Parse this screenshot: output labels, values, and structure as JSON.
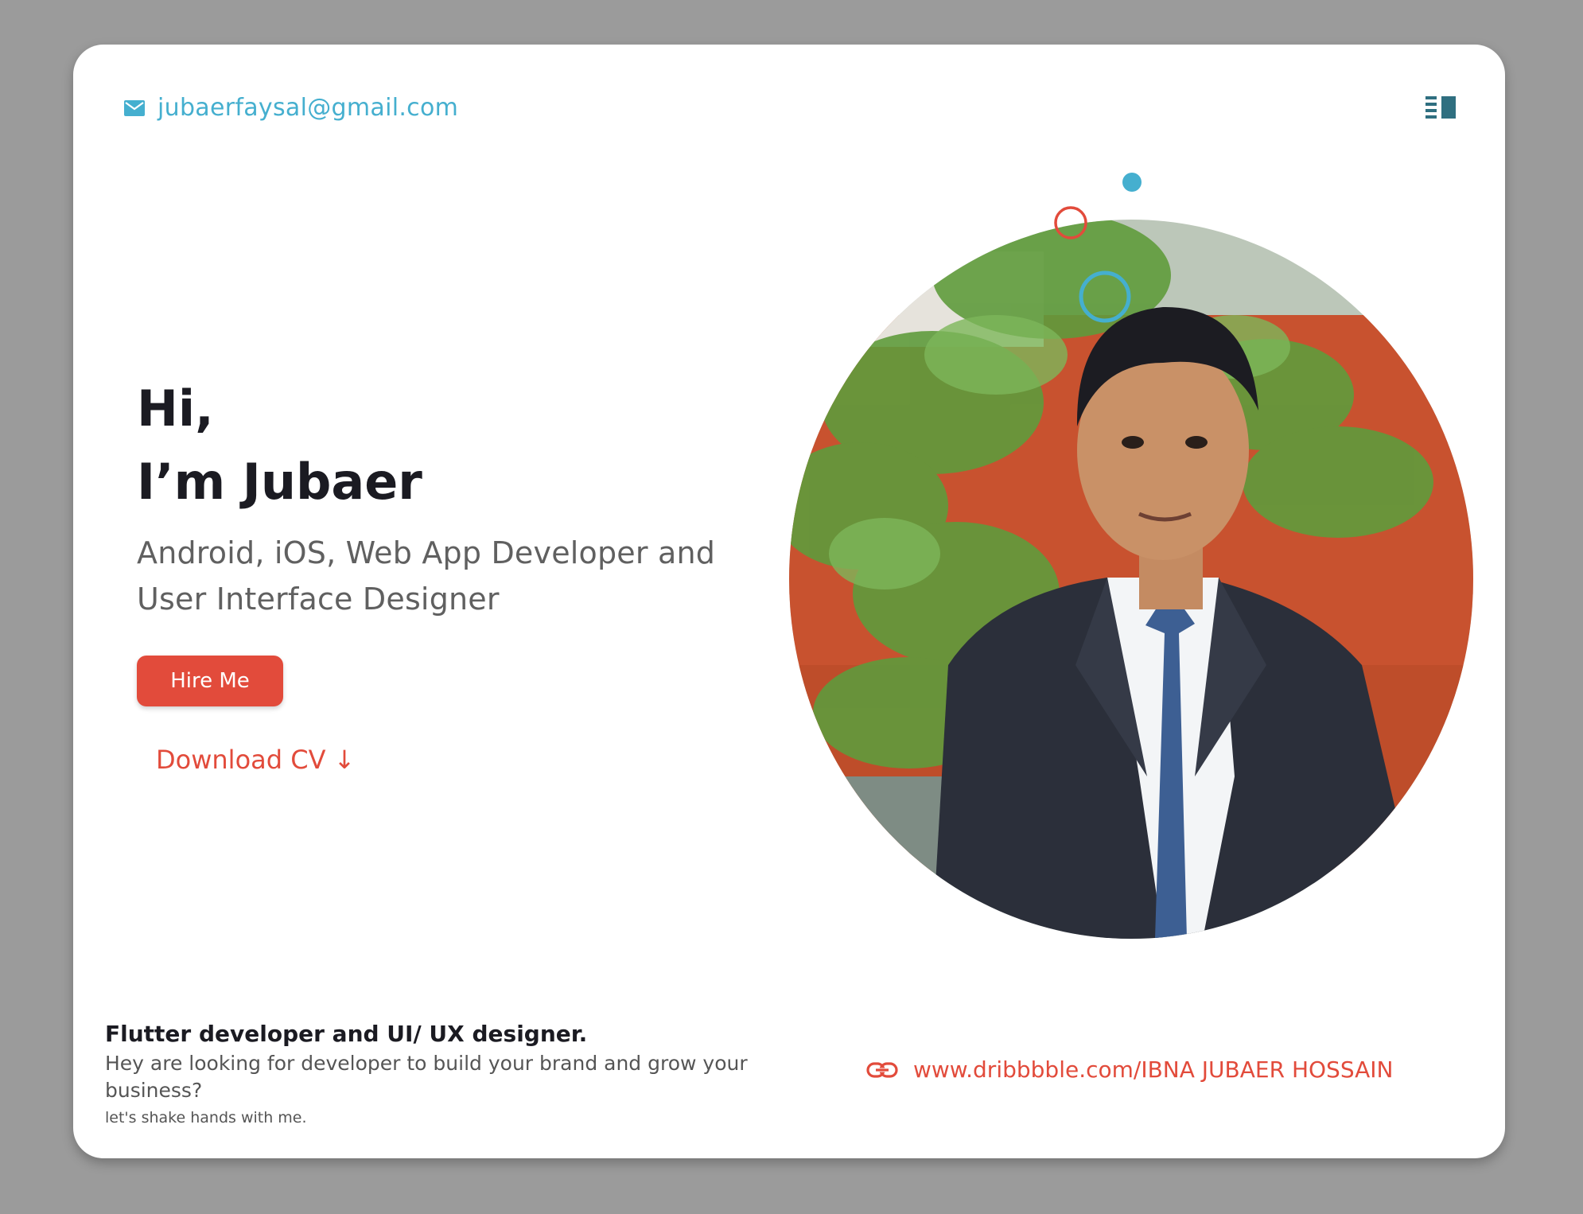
{
  "header": {
    "email": "jubaerfaysal@gmail.com",
    "email_icon": "mail-icon",
    "menu_icon": "menu-icon"
  },
  "hero": {
    "greeting_line1": "Hi,",
    "greeting_line2": "I’m Jubaer",
    "subtitle_line1": "Android, iOS, Web App Developer and",
    "subtitle_line2": "User Interface Designer",
    "hire_button": "Hire Me",
    "download_cv": "Download CV ↓"
  },
  "footer": {
    "title": "Flutter developer and UI/ UX designer.",
    "description": "Hey are looking for developer to build your brand and grow your business?",
    "note": "let's shake hands with me.",
    "link_text": "www.dribbbble.com/IBNA JUBAER HOSSAIN",
    "link_icon": "link-icon"
  },
  "colors": {
    "accent_red": "#e24b3b",
    "accent_blue": "#45afcf",
    "menu_teal": "#2f6f80",
    "text_dark": "#1b1b22",
    "background": "#9b9b9b"
  }
}
